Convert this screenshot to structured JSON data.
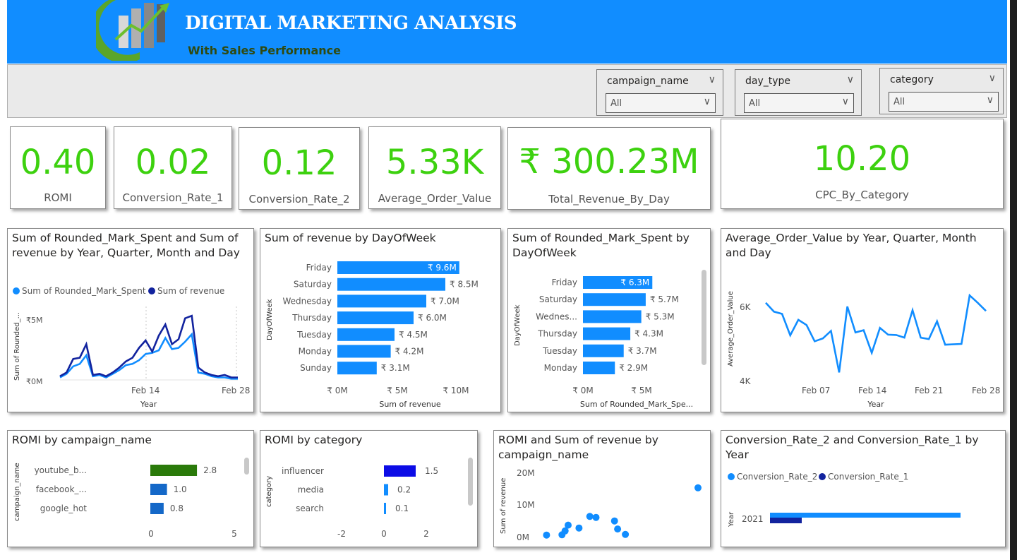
{
  "header": {
    "title": "DIGITAL MARKETING ANALYSIS",
    "subtitle": "With Sales Performance"
  },
  "slicers": [
    {
      "label": "campaign_name",
      "value": "All"
    },
    {
      "label": "day_type",
      "value": "All"
    },
    {
      "label": "category",
      "value": "All"
    }
  ],
  "kpis": [
    {
      "value": "0.40",
      "label": "ROMI"
    },
    {
      "value": "0.02",
      "label": "Conversion_Rate_1"
    },
    {
      "value": "0.12",
      "label": "Conversion_Rate_2"
    },
    {
      "value": "5.33K",
      "label": "Average_Order_Value"
    },
    {
      "value": "₹ 300.23M",
      "label": "Total_Revenue_By_Day"
    },
    {
      "value": "10.20",
      "label": "CPC_By_Category"
    }
  ],
  "colors": {
    "header": "#118dff",
    "kpi_green": "#3dd10f",
    "series_light": "#118dff",
    "series_dark": "#12239e",
    "romi_green": "#2a7a0a",
    "romi_blue": "#0c0ce6",
    "bar_blue2": "#1468c8"
  },
  "chart_data": [
    {
      "id": "line_mark_revenue",
      "type": "line",
      "title": "Sum of Rounded_Mark_Spent and Sum of revenue by Year, Quarter, Month and Day",
      "xlabel": "Year",
      "ylabel": "Sum of Rounded_...",
      "y_ticks": [
        "₹5M",
        "₹0M"
      ],
      "x_ticks": [
        "Feb 14",
        "Feb 28"
      ],
      "legend_position": "top-left",
      "series": [
        {
          "name": "Sum of Rounded_Mark_Spent",
          "values": [
            0.2,
            0.5,
            1.1,
            1.3,
            2.0,
            0.3,
            0.4,
            0.2,
            0.5,
            0.8,
            1.2,
            1.3,
            1.6,
            2.1,
            2.2,
            2.4,
            3.4,
            2.5,
            2.6,
            3.1,
            3.7,
            0.6,
            0.5,
            0.3,
            0.2,
            0.2,
            0.1,
            0.1
          ]
        },
        {
          "name": "Sum of revenue",
          "values": [
            0.3,
            0.6,
            1.7,
            1.8,
            2.9,
            0.4,
            0.5,
            0.3,
            0.6,
            1.0,
            1.5,
            1.8,
            2.6,
            3.2,
            2.3,
            3.6,
            4.5,
            2.9,
            3.3,
            5.0,
            5.2,
            1.0,
            0.6,
            0.4,
            0.3,
            0.4,
            0.2,
            0.2
          ]
        }
      ]
    },
    {
      "id": "bar_revenue_dow",
      "type": "bar",
      "title": "Sum of revenue by DayOfWeek",
      "xlabel": "Sum of revenue",
      "ylabel": "DayOfWeek",
      "categories": [
        "Friday",
        "Saturday",
        "Wednesday",
        "Thursday",
        "Tuesday",
        "Monday",
        "Sunday"
      ],
      "values": [
        9.6,
        8.5,
        7.0,
        6.0,
        4.5,
        4.2,
        3.1
      ],
      "data_labels": [
        "₹ 9.6M",
        "₹ 8.5M",
        "₹ 7.0M",
        "₹ 6.0M",
        "₹ 4.5M",
        "₹ 4.2M",
        "₹ 3.1M"
      ],
      "x_ticks": [
        "₹ 0M",
        "₹ 5M",
        "₹ 10M"
      ],
      "xlim": [
        0,
        12
      ]
    },
    {
      "id": "bar_mark_dow",
      "type": "bar",
      "title": "Sum of Rounded_Mark_Spent by DayOfWeek",
      "xlabel": "Sum of Rounded_Mark_Spe...",
      "ylabel": "DayOfWeek",
      "categories": [
        "Friday",
        "Saturday",
        "Wednes...",
        "Thursday",
        "Tuesday",
        "Monday"
      ],
      "values": [
        6.3,
        5.7,
        5.3,
        4.3,
        3.7,
        2.9
      ],
      "data_labels": [
        "₹ 6.3M",
        "₹ 5.7M",
        "₹ 5.3M",
        "₹ 4.3M",
        "₹ 3.7M",
        "₹ 2.9M"
      ],
      "x_ticks": [
        "₹ 0M",
        "₹ 5M"
      ],
      "xlim": [
        0,
        10
      ]
    },
    {
      "id": "line_aov",
      "type": "line",
      "title": "Average_Order_Value by Year, Quarter, Month and Day",
      "xlabel": "Year",
      "ylabel": "Average_Order_Value",
      "y_ticks": [
        "6K",
        "4K"
      ],
      "x_ticks": [
        "Feb 07",
        "Feb 14",
        "Feb 21",
        "Feb 28"
      ],
      "ylim": [
        4000,
        6000
      ],
      "series": [
        {
          "name": "Average_Order_Value",
          "values": [
            6100,
            5860,
            5800,
            5220,
            5640,
            5500,
            5060,
            5140,
            5340,
            4220,
            6000,
            5300,
            5360,
            4750,
            5420,
            5240,
            5230,
            5160,
            5900,
            5160,
            5120,
            5600,
            4970,
            4980,
            4990,
            6300,
            6100,
            5880
          ]
        }
      ]
    },
    {
      "id": "bar_romi_campaign",
      "type": "bar",
      "title": "ROMI by campaign_name",
      "ylabel": "campaign_name",
      "categories": [
        "youtube_b...",
        "facebook_...",
        "google_hot"
      ],
      "values": [
        2.8,
        1.0,
        0.8
      ],
      "data_labels": [
        "2.8",
        "1.0",
        "0.8"
      ],
      "x_ticks": [
        "0",
        "5"
      ],
      "xlim": [
        0,
        5
      ]
    },
    {
      "id": "bar_romi_category",
      "type": "bar",
      "title": "ROMI by category",
      "ylabel": "category",
      "categories": [
        "influencer",
        "media",
        "search"
      ],
      "values": [
        1.5,
        0.2,
        0.1
      ],
      "data_labels": [
        "1.5",
        "0.2",
        "0.1"
      ],
      "x_ticks": [
        "-2",
        "0",
        "2"
      ],
      "xlim": [
        -2,
        2
      ]
    },
    {
      "id": "scatter_romi_revenue",
      "type": "scatter",
      "title": "ROMI and Sum of revenue by campaign_name",
      "ylabel": "Sum of revenue",
      "y_ticks": [
        "20M",
        "10M",
        "0M"
      ],
      "ylim": [
        0,
        20
      ],
      "points": [
        {
          "x": 0.02,
          "y": 0.5
        },
        {
          "x": 0.12,
          "y": 0.6
        },
        {
          "x": 0.14,
          "y": 1.8
        },
        {
          "x": 0.16,
          "y": 3.6
        },
        {
          "x": 0.23,
          "y": 2.7
        },
        {
          "x": 0.3,
          "y": 6.3
        },
        {
          "x": 0.34,
          "y": 6.0
        },
        {
          "x": 0.46,
          "y": 4.9
        },
        {
          "x": 0.48,
          "y": 2.4
        },
        {
          "x": 0.53,
          "y": 0.7
        },
        {
          "x": 1.0,
          "y": 15.2
        }
      ]
    },
    {
      "id": "bar_conversion_year",
      "type": "bar",
      "title": "Conversion_Rate_2 and Conversion_Rate_1 by Year",
      "ylabel": "Year",
      "categories": [
        "2021"
      ],
      "legend_position": "top-left",
      "series": [
        {
          "name": "Conversion_Rate_2",
          "values": [
            0.12
          ]
        },
        {
          "name": "Conversion_Rate_1",
          "values": [
            0.02
          ]
        }
      ]
    }
  ]
}
